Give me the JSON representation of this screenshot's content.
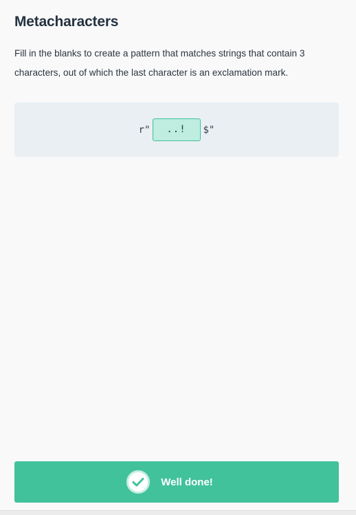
{
  "exercise": {
    "title": "Metacharacters",
    "instructions": "Fill in the blanks to create a pattern that matches strings that contain 3 characters, out of which the last character is an exclamation mark."
  },
  "code": {
    "prefix": "r\"",
    "blank_value": "..!",
    "suffix": "$\""
  },
  "feedback": {
    "message": "Well done!",
    "icon": "check-icon"
  },
  "colors": {
    "success": "#41c29b",
    "blank_fill": "#bfede0",
    "code_panel": "#e9eff3"
  }
}
